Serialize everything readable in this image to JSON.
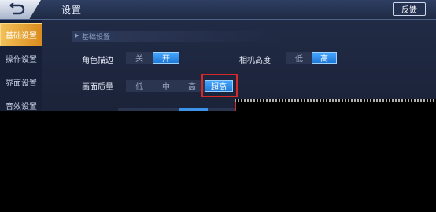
{
  "topbar": {
    "title": "设置",
    "feedback": "反馈"
  },
  "sidebar": {
    "items": [
      {
        "label": "基础设置",
        "active": true
      },
      {
        "label": "操作设置",
        "active": false
      },
      {
        "label": "界面设置",
        "active": false
      },
      {
        "label": "音效设置",
        "active": false
      }
    ]
  },
  "section": {
    "title": "基础设置"
  },
  "settings": {
    "outline": {
      "label": "角色描边",
      "options": [
        "关",
        "开"
      ],
      "selected": "开"
    },
    "camera": {
      "label": "相机高度",
      "options": [
        "低",
        "高"
      ],
      "selected": "高"
    },
    "quality": {
      "label": "画面质量",
      "options": [
        "低",
        "中",
        "高",
        "超高"
      ],
      "selected": "超高"
    }
  },
  "colors": {
    "accent": "#1f78d6",
    "highlight_box": "#d82828",
    "active_tab": "#e6a33a"
  }
}
